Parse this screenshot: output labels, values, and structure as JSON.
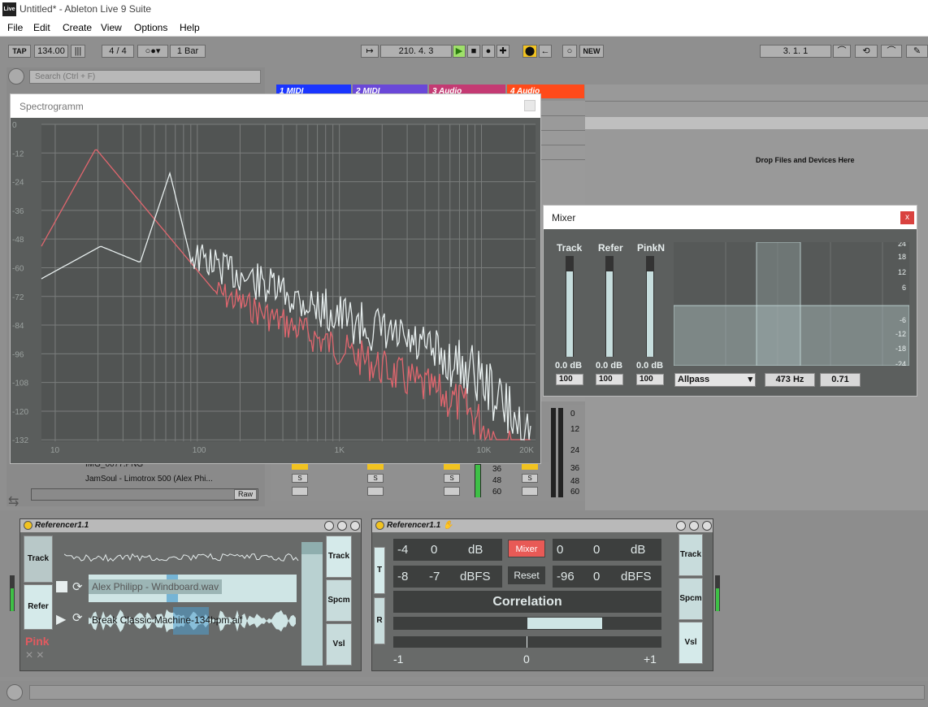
{
  "window": {
    "title": "Untitled* - Ableton Live 9 Suite",
    "logo_text": "Live"
  },
  "menu": [
    "File",
    "Edit",
    "Create",
    "View",
    "Options",
    "Help"
  ],
  "transport": {
    "tap": "TAP",
    "tempo": "134.00",
    "time_sig": "4 / 4",
    "quantize": "1 Bar",
    "position": "210.   4.   3",
    "new_label": "NEW",
    "loop_position": "3.   1.   1"
  },
  "browser": {
    "search_placeholder": "Search (Ctrl + F)",
    "files": [
      "IMG_0077.PNG",
      "JamSoul - Limotrox 500 (Alex Phi..."
    ],
    "raw_label": "Raw"
  },
  "tracks": [
    {
      "name": "1 MIDI",
      "color": "#1a35ff"
    },
    {
      "name": "2 MIDI",
      "color": "#6a48d8"
    },
    {
      "name": "3 Audio",
      "color": "#c43a73"
    },
    {
      "name": "4 Audio",
      "color": "#ff4a1a"
    }
  ],
  "arrangement": {
    "drop_text": "Drop Files and Devices Here"
  },
  "mixer_strip": {
    "scale": [
      "0",
      "12",
      "24",
      "36",
      "48",
      "60"
    ],
    "solo_label": "S"
  },
  "spectrogram": {
    "title": "Spectrogramm",
    "y_ticks": [
      "0",
      "-12",
      "-24",
      "-36",
      "-48",
      "-60",
      "-72",
      "-84",
      "-96",
      "-108",
      "-120",
      "-132"
    ],
    "x_ticks": [
      "10",
      "100",
      "1K",
      "10K",
      "20K"
    ],
    "pink_color": "#e0666e",
    "white_color": "#e7eeee"
  },
  "mixer": {
    "title": "Mixer",
    "close": "x",
    "channels": [
      {
        "label": "Track",
        "db": "0.0 dB",
        "vol": "100",
        "level": 0.85
      },
      {
        "label": "Refer",
        "db": "0.0 dB",
        "vol": "100",
        "level": 0.85
      },
      {
        "label": "PinkN",
        "db": "0.0 dB",
        "vol": "100",
        "level": 0.85
      }
    ],
    "eq_ticks": [
      "24",
      "18",
      "12",
      "6",
      "-6",
      "-12",
      "-18",
      "-24"
    ],
    "filter_type": "Allpass",
    "freq": "473 Hz",
    "q": "0.71"
  },
  "device1": {
    "title": "Referencer1.1",
    "track_btn": "Track",
    "refer_btn": "Refer",
    "pink_label": "Pink",
    "file_a": "Alex Philipp - Windboard.wav",
    "file_b": "Break Classic Machine-134bpm.aif",
    "side": [
      "Track",
      "Spcm",
      "Vsl"
    ]
  },
  "device2": {
    "title": "Referencer1.1",
    "t": "T",
    "r": "R",
    "row1": [
      "-4",
      "0",
      "dB"
    ],
    "row2": [
      "-8",
      "-7",
      "dBFS"
    ],
    "row1r": [
      "0",
      "0",
      "dB"
    ],
    "row2r": [
      "-96",
      "0",
      "dBFS"
    ],
    "mixer_btn": "Mixer",
    "reset_btn": "Reset",
    "correlation": "Correlation",
    "corr_scale": [
      "-1",
      "0",
      "+1"
    ],
    "side": [
      "Track",
      "Spcm",
      "Vsl"
    ]
  }
}
